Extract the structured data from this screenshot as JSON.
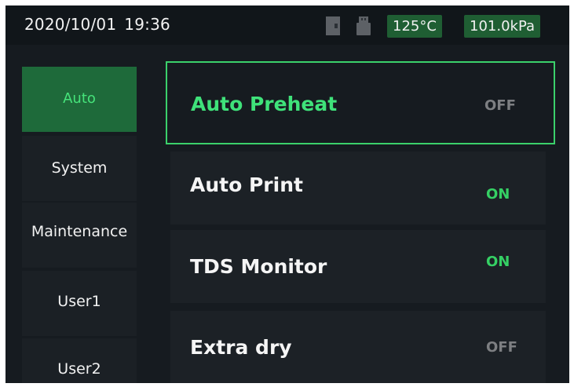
{
  "header": {
    "date": "2020/10/01",
    "time": "19:36",
    "icons": [
      "sd-card-icon",
      "usb-drive-icon"
    ],
    "temperature": "125°C",
    "pressure": "101.0kPa"
  },
  "sidebar": {
    "items": [
      {
        "label": "Auto",
        "active": true
      },
      {
        "label": "System",
        "active": false
      },
      {
        "label": "Maintenance",
        "active": false
      },
      {
        "label": "User1",
        "active": false
      },
      {
        "label": "User2",
        "active": false
      }
    ]
  },
  "settings": {
    "rows": [
      {
        "label": "Auto Preheat",
        "value": "OFF",
        "selected": true
      },
      {
        "label": "Auto Print",
        "value": "ON",
        "selected": false
      },
      {
        "label": "TDS Monitor",
        "value": "ON",
        "selected": false
      },
      {
        "label": "Extra dry",
        "value": "OFF",
        "selected": false
      }
    ]
  },
  "colors": {
    "background": "#161b20",
    "accent": "#3fe27a",
    "badge": "#1f5e33",
    "active_tab": "#1e6a3a",
    "off_text": "#7d7f82"
  }
}
